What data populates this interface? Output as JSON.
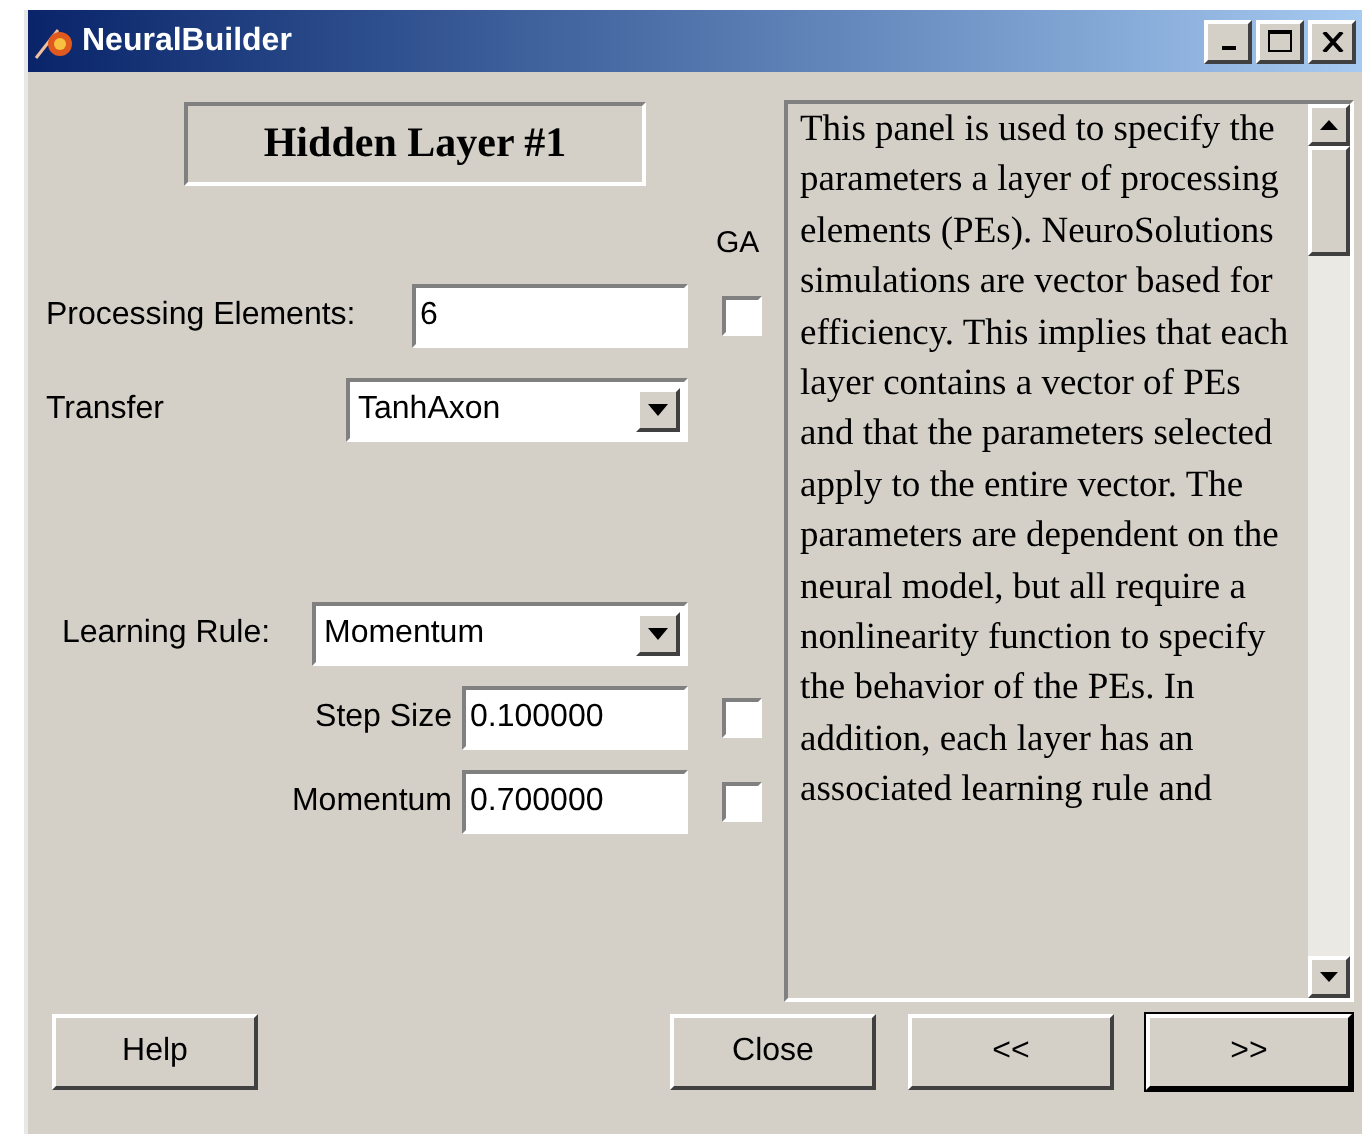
{
  "window": {
    "title": "NeuralBuilder"
  },
  "heading": "Hidden Layer #1",
  "ga_label": "GA",
  "rows": [
    {
      "kind": "text",
      "label": "Processing Elements:",
      "value": "6",
      "checked": false
    },
    {
      "kind": "dropdown",
      "label": "Transfer",
      "value": "TanhAxon"
    },
    {
      "kind": "dropdown",
      "label": "Learning Rule:",
      "value": "Momentum"
    },
    {
      "kind": "text",
      "label": "Step Size",
      "value": "0.100000",
      "checked": false
    },
    {
      "kind": "text",
      "label": "Momentum",
      "value": "0.700000",
      "checked": false
    }
  ],
  "help_text": "This panel is used to specify the parameters a layer of processing elements (PEs). NeuroSolutions simulations are vector based for efficiency. This implies that each layer contains a vector of PEs and that the parameters selected apply to the entire vector. The parameters are dependent on the neural model, but all require a nonlinearity function to specify the behavior of the PEs. In addition, each layer has an associated learning rule and",
  "buttons": [
    {
      "label": "Help",
      "default": false
    },
    {
      "label": "Close",
      "default": false
    },
    {
      "label": "<<",
      "default": false
    },
    {
      "label": ">>",
      "default": true
    }
  ]
}
